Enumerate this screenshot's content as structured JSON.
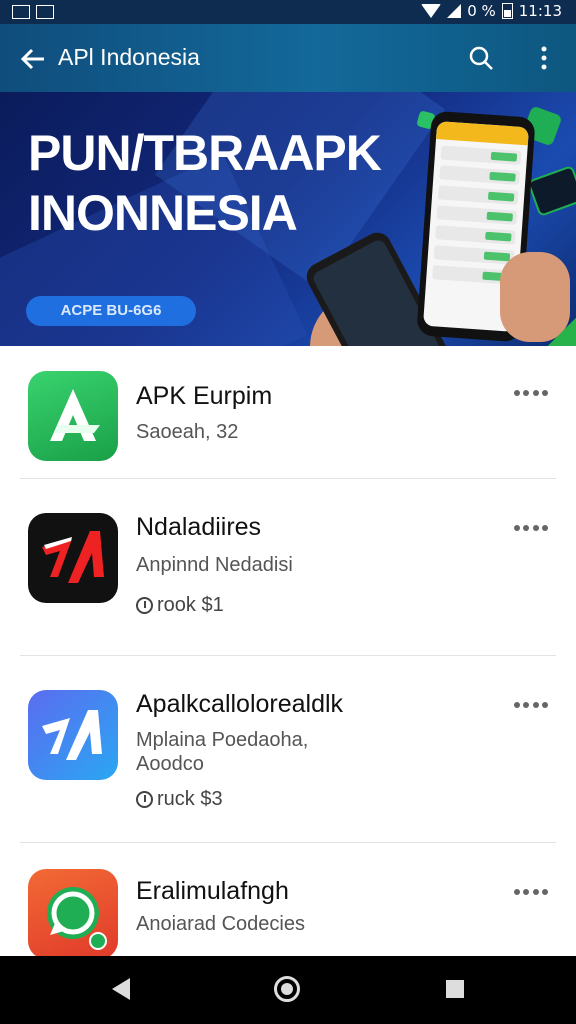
{
  "status_bar": {
    "left_icons": [
      "screenshot-icon",
      "screen-record-icon"
    ],
    "battery_text": "0 %",
    "time": "11:13"
  },
  "app_bar": {
    "title": "APl Indonesia"
  },
  "banner": {
    "headline_line1": "PUN/TBRAAPK",
    "headline_line2": "INONNESIA",
    "pill_label": "ACPE BU-6G6"
  },
  "apps": [
    {
      "name": "APK Eurpim",
      "subtitle": "Saoeah, 32",
      "meta": ""
    },
    {
      "name": "Ndaladiires",
      "subtitle": "Anpinnd Nedadisi",
      "meta": "rook $1"
    },
    {
      "name": "Apalkcallolorealdlk",
      "subtitle": "Mplaina Poedaoha, Aoodco",
      "meta": "ruck $3"
    },
    {
      "name": "Eralimulafngh",
      "subtitle": "Anoiarad Codecies",
      "meta": ""
    }
  ],
  "colors": {
    "app_bar": "#13699a",
    "banner": "#13287d",
    "accent_green": "#27b34a"
  }
}
